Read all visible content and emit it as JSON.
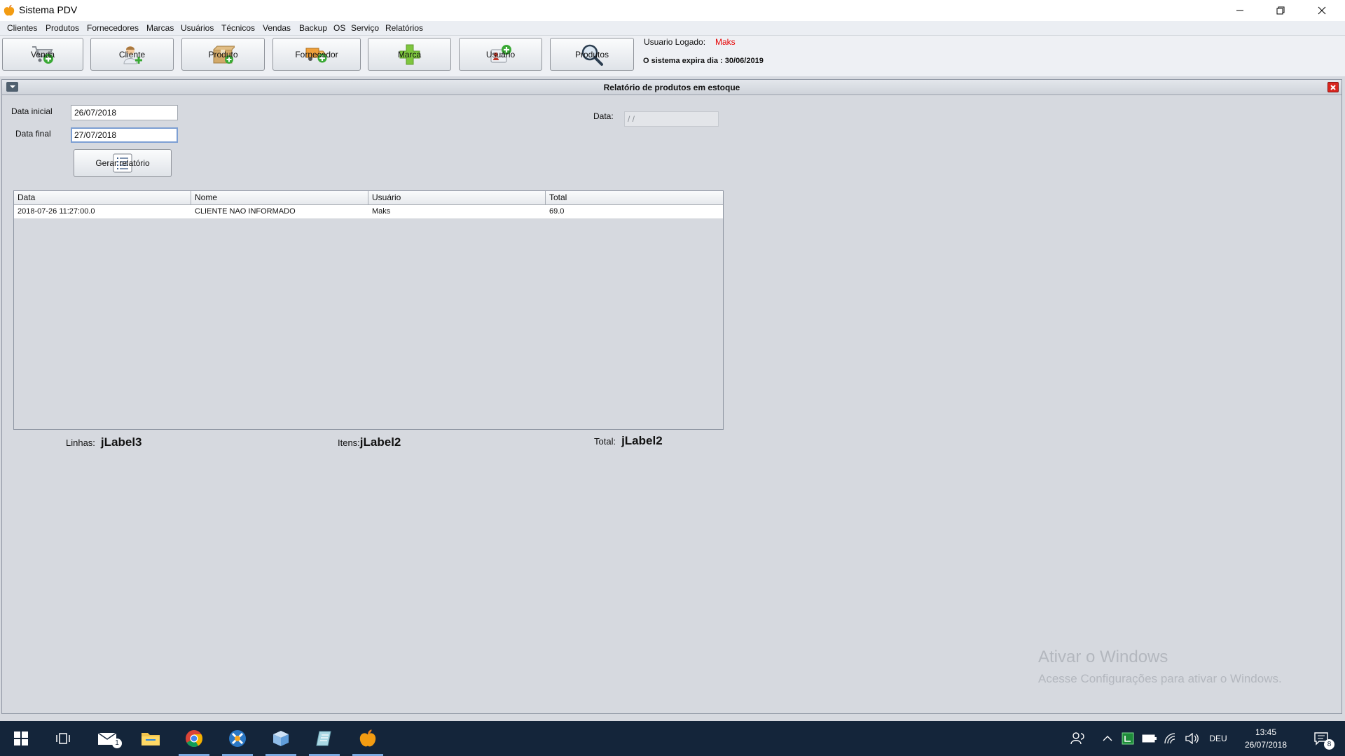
{
  "window": {
    "title": "Sistema PDV"
  },
  "menu": {
    "items": [
      "Clientes",
      "Produtos",
      "Fornecedores",
      "Marcas",
      "Usuários",
      "Técnicos",
      "Vendas",
      "Backup",
      "OS",
      "Serviço",
      "Relatórios"
    ]
  },
  "toolbar": {
    "buttons": [
      {
        "label": "Venda",
        "icon": "cart-add-icon"
      },
      {
        "label": "Cliente",
        "icon": "person-add-icon"
      },
      {
        "label": "Produto",
        "icon": "box-add-icon"
      },
      {
        "label": "Fornecedor",
        "icon": "truck-add-icon"
      },
      {
        "label": "Marca",
        "icon": "plus-icon"
      },
      {
        "label": "Usuário",
        "icon": "user-card-add-icon"
      },
      {
        "label": "Produtos",
        "icon": "magnifier-icon"
      }
    ],
    "user_label": "Usuario Logado:",
    "user_name": "Maks",
    "user_name_color": "#e60000",
    "expiry_text": "O sistema expira dia : 30/06/2019"
  },
  "report": {
    "title": "Relatório de produtos em estoque",
    "start_label": "Data inicial",
    "start_value": "26/07/2018",
    "end_label": "Data final",
    "end_value": "27/07/2018",
    "date_label": "Data:",
    "date_value": "/ /",
    "generate_label": "Gerar relatório",
    "table": {
      "columns": [
        "Data",
        "Nome",
        "Usuário",
        "Total"
      ],
      "rows": [
        [
          "2018-07-26 11:27:00.0",
          "CLIENTE NAO INFORMADO",
          "Maks",
          "69.0"
        ]
      ]
    },
    "summary": {
      "lines_label": "Linhas:",
      "lines_value": "jLabel3",
      "items_label": "Itens:",
      "items_value": "jLabel2",
      "total_label": "Total:",
      "total_value": "jLabel2"
    }
  },
  "watermark": {
    "line1": "Ativar o Windows",
    "line2": "Acesse Configurações para ativar o Windows."
  },
  "taskbar": {
    "mail_badge": "1",
    "language": "DEU",
    "time": "13:45",
    "date": "26/07/2018",
    "notification_count": "8"
  }
}
